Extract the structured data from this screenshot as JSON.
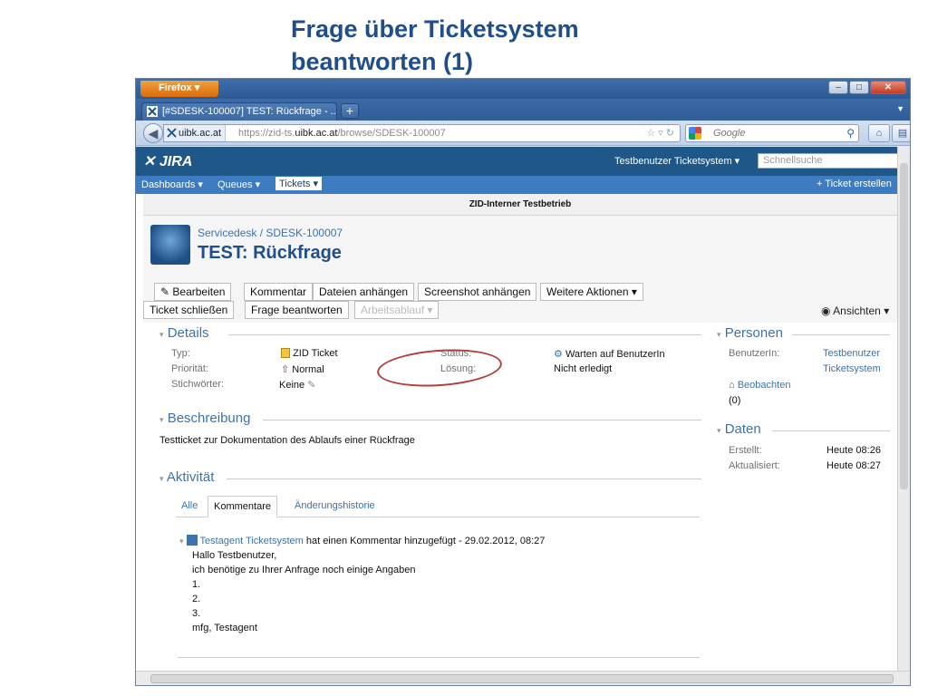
{
  "slide": {
    "title_line1": "Frage über Ticketsystem",
    "title_line2": "beantworten (1)"
  },
  "browser": {
    "firefox_button": "Firefox",
    "tab_title": "[#SDESK-100007] TEST: Rückfrage - ...",
    "site_identity": "uibk.ac.at",
    "url_prefix": "https://zid-ts.",
    "url_domain": "uibk.ac.at",
    "url_path": "/browse/SDESK-100007",
    "search_placeholder": "Google"
  },
  "jira": {
    "logo": "JIRA",
    "user_menu": "Testbenutzer Ticketsystem",
    "search_placeholder": "Schnellsuche",
    "nav": [
      "Dashboards",
      "Queues",
      "Tickets"
    ],
    "create_label": "Ticket erstellen",
    "env_banner": "ZID-Interner Testbetrieb"
  },
  "issue": {
    "breadcrumb": "Servicedesk / SDESK-100007",
    "title": "TEST: Rückfrage"
  },
  "ops": {
    "row1": [
      "Bearbeiten",
      "Kommentar",
      "Dateien anhängen",
      "Screenshot anhängen",
      "Weitere Aktionen ▾"
    ],
    "row2": [
      "Ticket schließen",
      "Frage beantworten",
      "Arbeitsablauf ▾"
    ],
    "ansichten": "Ansichten ▾"
  },
  "details": {
    "heading": "Details",
    "type_label": "Typ:",
    "type_value": "ZID Ticket",
    "priority_label": "Priorität:",
    "priority_value": "Normal",
    "keywords_label": "Stichwörter:",
    "keywords_value": "Keine",
    "status_label": "Status:",
    "status_value": "Warten auf BenutzerIn",
    "resolution_label": "Lösung:",
    "resolution_value": "Nicht erledigt"
  },
  "description": {
    "heading": "Beschreibung",
    "text": "Testticket zur Dokumentation des Ablaufs einer Rückfrage"
  },
  "activity": {
    "heading": "Aktivität",
    "tabs": [
      "Alle",
      "Kommentare",
      "Änderungshistorie"
    ]
  },
  "comment": {
    "author": "Testagent Ticketsystem",
    "meta": "hat einen Kommentar hinzugefügt - 29.02.2012, 08:27",
    "lines": [
      "Hallo Testbenutzer,",
      "ich benötige zu Ihrer Anfrage noch einige Angaben",
      "1.",
      "2.",
      "3.",
      "mfg, Testagent"
    ]
  },
  "people": {
    "heading": "Personen",
    "user_label": "BenutzerIn:",
    "user_value_1": "Testbenutzer",
    "user_value_2": "Ticketsystem",
    "watch_label": "Beobachten",
    "watch_count": "(0)"
  },
  "dates": {
    "heading": "Daten",
    "created_label": "Erstellt:",
    "created_value": "Heute 08:26",
    "updated_label": "Aktualisiert:",
    "updated_value": "Heute 08:27"
  },
  "colors": {
    "jira_header": "#1f5788",
    "jira_nav": "#3d7cc1",
    "link": "#3b73af",
    "annotation": "#b43d3d"
  }
}
